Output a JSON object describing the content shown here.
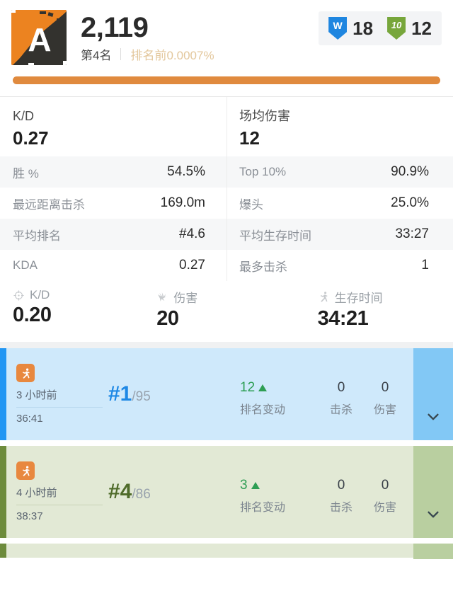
{
  "header": {
    "avatar_letter": "A",
    "avatar_icon": "grunge-square-avatar",
    "score": "2,119",
    "rank_name": "第4名",
    "percentile": "排名前0.0007%",
    "badges": [
      {
        "icon": "shield-win-icon",
        "glyph": "W",
        "count": "18",
        "color": "#1f86e0"
      },
      {
        "icon": "shield-top10-icon",
        "glyph": "10",
        "count": "12",
        "color": "#77a63b"
      }
    ],
    "progress_percent": 100,
    "progress_color": "#e08a3e"
  },
  "stats": {
    "left": {
      "headline_label": "K/D",
      "headline_value": "0.27",
      "rows": [
        {
          "k": "胜 %",
          "v": "54.5%"
        },
        {
          "k": "最远距离击杀",
          "v": "169.0m"
        },
        {
          "k": "平均排名",
          "v": "#4.6"
        },
        {
          "k": "KDA",
          "v": "0.27"
        }
      ]
    },
    "right": {
      "headline_label": "场均伤害",
      "headline_value": "12",
      "rows": [
        {
          "k": "Top 10%",
          "v": "90.9%"
        },
        {
          "k": "爆头",
          "v": "25.0%"
        },
        {
          "k": "平均生存时间",
          "v": "33:27"
        },
        {
          "k": "最多击杀",
          "v": "1"
        }
      ]
    }
  },
  "summary": [
    {
      "icon": "crosshair-icon",
      "label": "K/D",
      "value": "0.20"
    },
    {
      "icon": "damage-burst-icon",
      "label": "伤害",
      "value": "20"
    },
    {
      "icon": "runner-icon",
      "label": "生存时间",
      "value": "34:21"
    }
  ],
  "matches": [
    {
      "theme": "blue",
      "mode_icon": "runner-icon",
      "time_ago": "3 小时前",
      "duration": "36:41",
      "rank": "#1",
      "rank_total": "/95",
      "delta_value": "12",
      "delta_icon": "triangle-up-icon",
      "delta_label": "排名变动",
      "kills_value": "0",
      "kills_label": "击杀",
      "damage_value": "0",
      "damage_label": "伤害",
      "expand_icon": "chevron-down-icon"
    },
    {
      "theme": "green",
      "mode_icon": "runner-icon",
      "time_ago": "4 小时前",
      "duration": "38:37",
      "rank": "#4",
      "rank_total": "/86",
      "delta_value": "3",
      "delta_icon": "triangle-up-icon",
      "delta_label": "排名变动",
      "kills_value": "0",
      "kills_label": "击杀",
      "damage_value": "0",
      "damage_label": "伤害",
      "expand_icon": "chevron-down-icon"
    }
  ]
}
